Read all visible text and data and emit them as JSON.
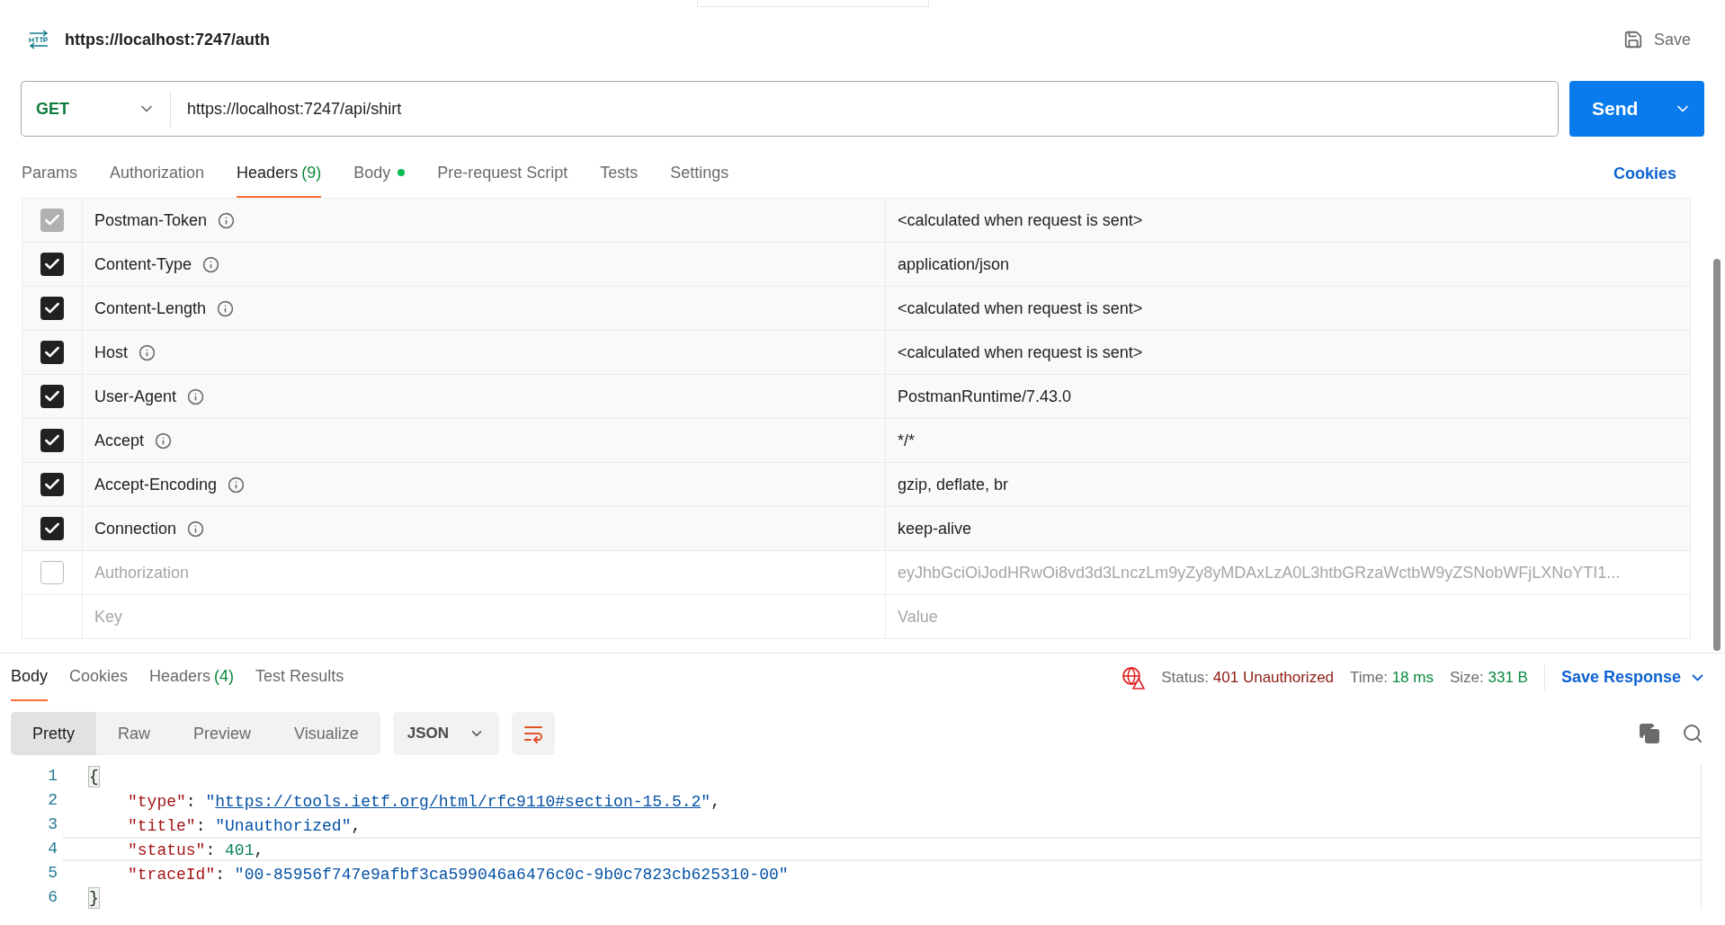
{
  "request": {
    "title": "https://localhost:7247/auth",
    "save_label": "Save",
    "method": "GET",
    "url": "https://localhost:7247/api/shirt",
    "send_label": "Send"
  },
  "request_tabs": [
    {
      "label": "Params",
      "selected": false
    },
    {
      "label": "Authorization",
      "selected": false
    },
    {
      "label": "Headers",
      "count": "(9)",
      "selected": true
    },
    {
      "label": "Body",
      "dot": true,
      "selected": false
    },
    {
      "label": "Pre-request Script",
      "selected": false
    },
    {
      "label": "Tests",
      "selected": false
    },
    {
      "label": "Settings",
      "selected": false
    }
  ],
  "cookies_link": "Cookies",
  "headers": [
    {
      "key": "Postman-Token",
      "value": "<calculated when request is sent>",
      "checked": true,
      "disabled": true
    },
    {
      "key": "Content-Type",
      "value": "application/json",
      "checked": true,
      "disabled": false
    },
    {
      "key": "Content-Length",
      "value": "<calculated when request is sent>",
      "checked": true,
      "disabled": false
    },
    {
      "key": "Host",
      "value": "<calculated when request is sent>",
      "checked": true,
      "disabled": false
    },
    {
      "key": "User-Agent",
      "value": "PostmanRuntime/7.43.0",
      "checked": true,
      "disabled": false
    },
    {
      "key": "Accept",
      "value": "*/*",
      "checked": true,
      "disabled": false
    },
    {
      "key": "Accept-Encoding",
      "value": "gzip, deflate, br",
      "checked": true,
      "disabled": false
    },
    {
      "key": "Connection",
      "value": "keep-alive",
      "checked": true,
      "disabled": false
    },
    {
      "key": "Authorization",
      "value": "eyJhbGciOiJodHRwOi8vd3d3LnczLm9yZy8yMDAxLzA0L3htbGRzaWctbW9yZSNobWFjLXNoYTI1...",
      "checked": false,
      "disabled": false
    }
  ],
  "new_header": {
    "key_placeholder": "Key",
    "value_placeholder": "Value"
  },
  "response_tabs": [
    {
      "label": "Body",
      "selected": true
    },
    {
      "label": "Cookies",
      "selected": false
    },
    {
      "label": "Headers",
      "count": "(4)",
      "selected": false
    },
    {
      "label": "Test Results",
      "selected": false
    }
  ],
  "response_status": {
    "status_label": "Status:",
    "status": "401 Unauthorized",
    "time_label": "Time:",
    "time": "18 ms",
    "size_label": "Size:",
    "size": "331 B",
    "save_response": "Save Response"
  },
  "view_modes": [
    {
      "label": "Pretty",
      "selected": true
    },
    {
      "label": "Raw",
      "selected": false
    },
    {
      "label": "Preview",
      "selected": false
    },
    {
      "label": "Visualize",
      "selected": false
    }
  ],
  "format": "JSON",
  "code": {
    "line_numbers": [
      "1",
      "2",
      "3",
      "4",
      "5",
      "6"
    ],
    "open": "{",
    "close": "}",
    "members": [
      {
        "key": "\"type\"",
        "colon": ":",
        "value": [
          {
            "kind": "string",
            "text": "\""
          },
          {
            "kind": "link",
            "text": "https://tools.ietf.org/html/rfc9110#section-15.5.2"
          },
          {
            "kind": "string",
            "text": "\""
          }
        ],
        "end": ",",
        "active": false
      },
      {
        "key": "\"title\"",
        "colon": ":",
        "value": [
          {
            "kind": "string",
            "text": "\"Unauthorized\""
          }
        ],
        "end": ",",
        "active": false
      },
      {
        "key": "\"status\"",
        "colon": ":",
        "value": [
          {
            "kind": "number",
            "text": "401"
          }
        ],
        "end": ",",
        "active": true
      },
      {
        "key": "\"traceId\"",
        "colon": ":",
        "value": [
          {
            "kind": "string",
            "text": "\"00-85956f747e9afbf3ca599046a6476c0c-9b0c7823cb625310-00\""
          }
        ],
        "active": false
      }
    ]
  }
}
